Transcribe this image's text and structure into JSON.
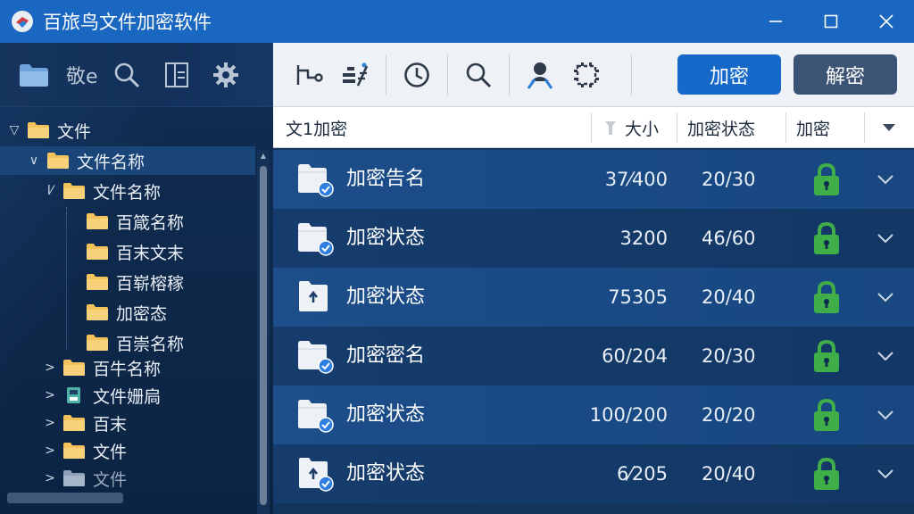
{
  "window": {
    "title": "百旅鸟文件加密软件",
    "controls": [
      "minimize-icon",
      "maximize-icon",
      "close-icon"
    ]
  },
  "sidebar": {
    "toolbar_label": "敬e",
    "tree": [
      {
        "label": "文件",
        "depth": 0,
        "arrow": "▽",
        "icon": "folder"
      },
      {
        "label": "文件名称",
        "depth": 1,
        "arrow": "∨",
        "icon": "folder",
        "selected": true
      },
      {
        "label": "文件名称",
        "depth": 2,
        "arrow": "l⁄",
        "icon": "folder"
      },
      {
        "label": "百箴名称",
        "depth": 3,
        "arrow": "",
        "icon": "folder"
      },
      {
        "label": "百末文末",
        "depth": 3,
        "arrow": "",
        "icon": "folder"
      },
      {
        "label": "百崭榕稼",
        "depth": 3,
        "arrow": "",
        "icon": "folder"
      },
      {
        "label": "加密态",
        "depth": 3,
        "arrow": "",
        "icon": "folder"
      },
      {
        "label": "百崇名称",
        "depth": 3,
        "arrow": "",
        "icon": "folder"
      },
      {
        "label": "百牛名称",
        "depth": 2,
        "arrow": ">",
        "icon": "folder"
      },
      {
        "label": "文件姗扃",
        "depth": 2,
        "arrow": ">",
        "icon": "drive"
      },
      {
        "label": "百末",
        "depth": 2,
        "arrow": ">",
        "icon": "folder"
      },
      {
        "label": "文件",
        "depth": 2,
        "arrow": ">",
        "icon": "folder"
      },
      {
        "label": "文件",
        "depth": 2,
        "arrow": ">",
        "icon": "folder-dim"
      }
    ]
  },
  "toolbar": {
    "encrypt_label": "加密",
    "decrypt_label": "解密"
  },
  "table": {
    "headers": {
      "name": "文1加密",
      "size": "大小",
      "status": "加密状态",
      "lock": "加密"
    },
    "rows": [
      {
        "name": "加密告名",
        "size": "37⁄400",
        "status": "20/30",
        "file_icon": "folder-check"
      },
      {
        "name": "加密状态",
        "size": "3200",
        "status": "46/60",
        "file_icon": "folder-check"
      },
      {
        "name": "加密状态",
        "size": "75305",
        "status": "20/40",
        "file_icon": "file-up"
      },
      {
        "name": "加密密名",
        "size": "60/204",
        "status": "20/30",
        "file_icon": "folder-check"
      },
      {
        "name": "加密状态",
        "size": "100/200",
        "status": "20/20",
        "file_icon": "folder-check"
      },
      {
        "name": "加密状态",
        "size": "6⁄205",
        "status": "20/40",
        "file_icon": "file-up-check"
      }
    ]
  },
  "colors": {
    "titlebar": "#1967c0",
    "accent": "#1769c9",
    "lock_green": "#3fae49",
    "check_blue": "#2f7fe0"
  }
}
